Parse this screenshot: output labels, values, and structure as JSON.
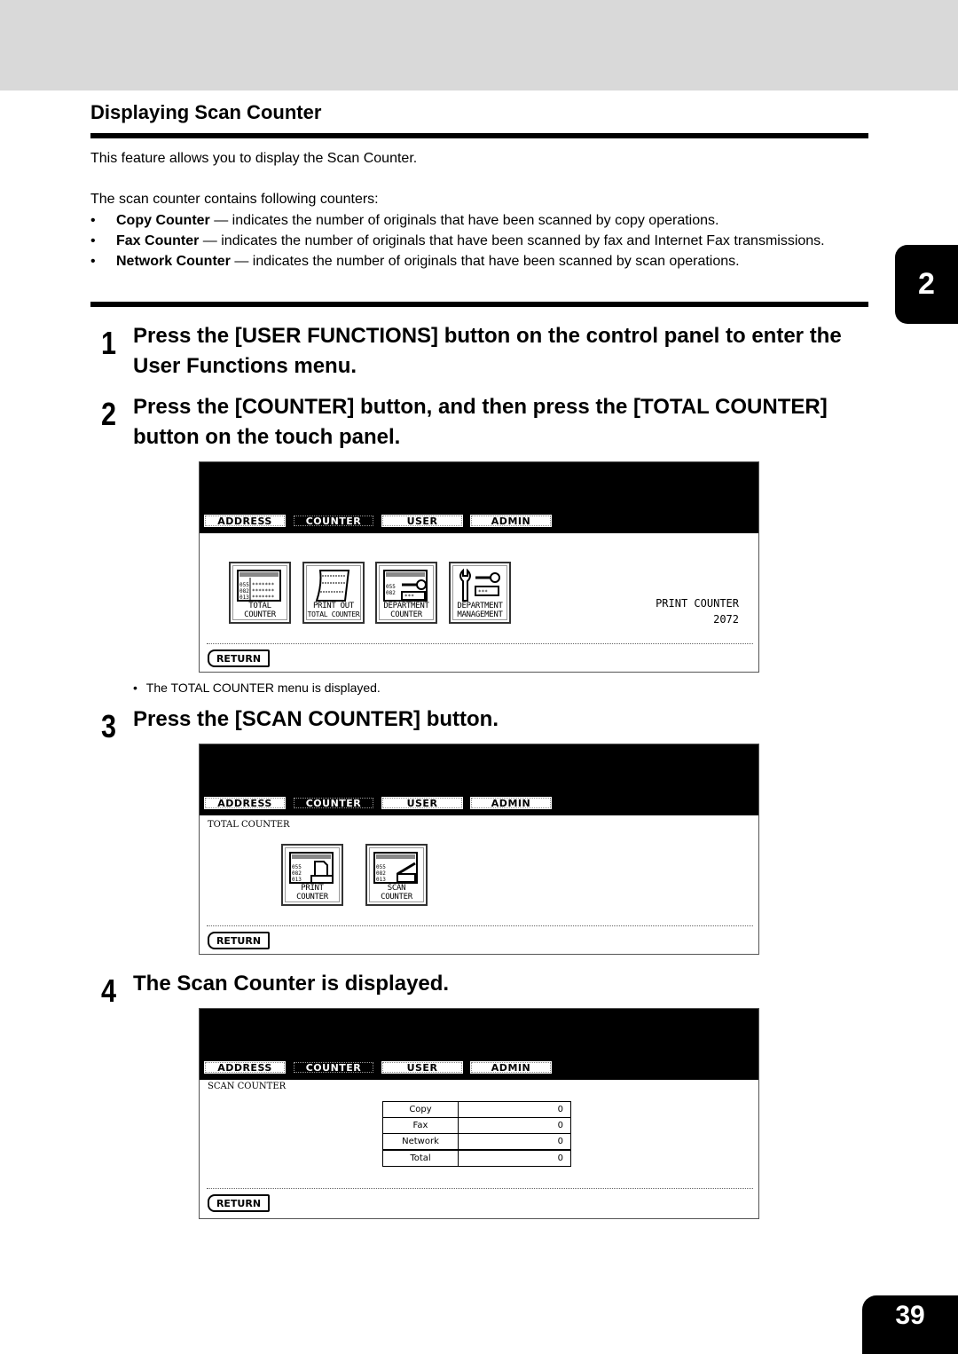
{
  "section": {
    "title": "Displaying Scan Counter",
    "intro": "This feature allows you to display the Scan Counter.",
    "lead": "The scan counter contains following counters:",
    "bullets": [
      {
        "term": "Copy Counter",
        "text": " — indicates the number of originals that have been scanned by copy operations."
      },
      {
        "term": "Fax Counter",
        "text": " — indicates the number of originals that have been scanned by fax and Internet Fax transmissions."
      },
      {
        "term": "Network Counter",
        "text": " — indicates the number of originals that have been scanned by scan operations."
      }
    ],
    "bullet_glyph": "•"
  },
  "chapter_tab": "2",
  "page_number": "39",
  "steps": [
    {
      "num": "1",
      "text": "Press the [USER FUNCTIONS] button on the control panel to enter the User Functions menu."
    },
    {
      "num": "2",
      "text": "Press the [COUNTER] button, and then press the [TOTAL COUNTER] button on the touch panel."
    },
    {
      "num": "3",
      "text": "Press the [SCAN COUNTER] button."
    },
    {
      "num": "4",
      "text": "The Scan Counter is displayed."
    }
  ],
  "notes": {
    "after_step2": "The TOTAL COUNTER menu is displayed."
  },
  "panel_common": {
    "tabs": [
      "ADDRESS",
      "COUNTER",
      "USER",
      "ADMIN"
    ],
    "active_tab": "COUNTER",
    "return_label": "RETURN"
  },
  "panel1": {
    "buttons": [
      {
        "line1": "TOTAL",
        "line2": "COUNTER"
      },
      {
        "line1": "PRINT OUT",
        "line2": "TOTAL COUNTER"
      },
      {
        "line1": "DEPARTMENT",
        "line2": "COUNTER"
      },
      {
        "line1": "DEPARTMENT",
        "line2": "MANAGEMENT"
      }
    ],
    "readout_label": "PRINT COUNTER",
    "readout_value": "2072"
  },
  "panel2": {
    "label": "TOTAL COUNTER",
    "buttons": [
      {
        "line1": "PRINT",
        "line2": "COUNTER"
      },
      {
        "line1": "SCAN",
        "line2": "COUNTER"
      }
    ]
  },
  "panel3": {
    "label": "SCAN COUNTER",
    "rows": [
      {
        "name": "Copy",
        "value": "0"
      },
      {
        "name": "Fax",
        "value": "0"
      },
      {
        "name": "Network",
        "value": "0"
      },
      {
        "name": "Total",
        "value": "0"
      }
    ]
  }
}
